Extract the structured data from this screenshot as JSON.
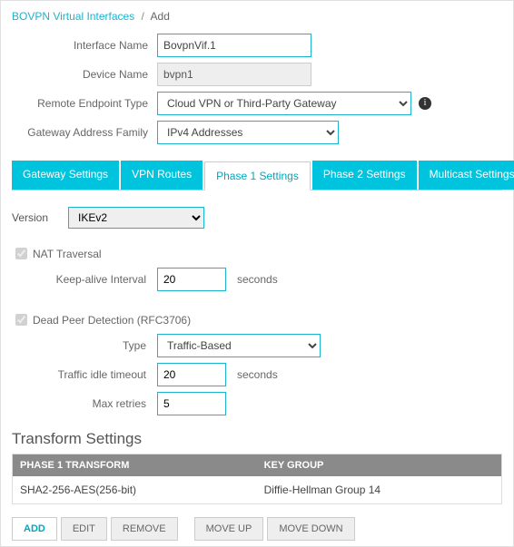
{
  "breadcrumb": {
    "root": "BOVPN Virtual Interfaces",
    "current": "Add"
  },
  "form": {
    "interface_name_label": "Interface Name",
    "interface_name_value": "BovpnVif.1",
    "device_name_label": "Device Name",
    "device_name_value": "bvpn1",
    "remote_ep_label": "Remote Endpoint Type",
    "remote_ep_value": "Cloud VPN or Third-Party Gateway",
    "gw_family_label": "Gateway Address Family",
    "gw_family_value": "IPv4 Addresses"
  },
  "tabs": {
    "gateway": "Gateway Settings",
    "vpn": "VPN Routes",
    "phase1": "Phase 1 Settings",
    "phase2": "Phase 2 Settings",
    "multicast": "Multicast Settings"
  },
  "phase1": {
    "version_label": "Version",
    "version_value": "IKEv2",
    "nat_label": "NAT Traversal",
    "keepalive_label": "Keep-alive Interval",
    "keepalive_value": "20",
    "seconds": "seconds",
    "dpd_label": "Dead Peer Detection (RFC3706)",
    "type_label": "Type",
    "type_value": "Traffic-Based",
    "idle_label": "Traffic idle timeout",
    "idle_value": "20",
    "retries_label": "Max retries",
    "retries_value": "5"
  },
  "transform": {
    "title": "Transform Settings",
    "col1": "PHASE 1 TRANSFORM",
    "col2": "KEY GROUP",
    "row_transform": "SHA2-256-AES(256-bit)",
    "row_keygroup": "Diffie-Hellman Group 14"
  },
  "buttons": {
    "add": "ADD",
    "edit": "EDIT",
    "remove": "REMOVE",
    "moveup": "MOVE UP",
    "movedown": "MOVE DOWN"
  }
}
